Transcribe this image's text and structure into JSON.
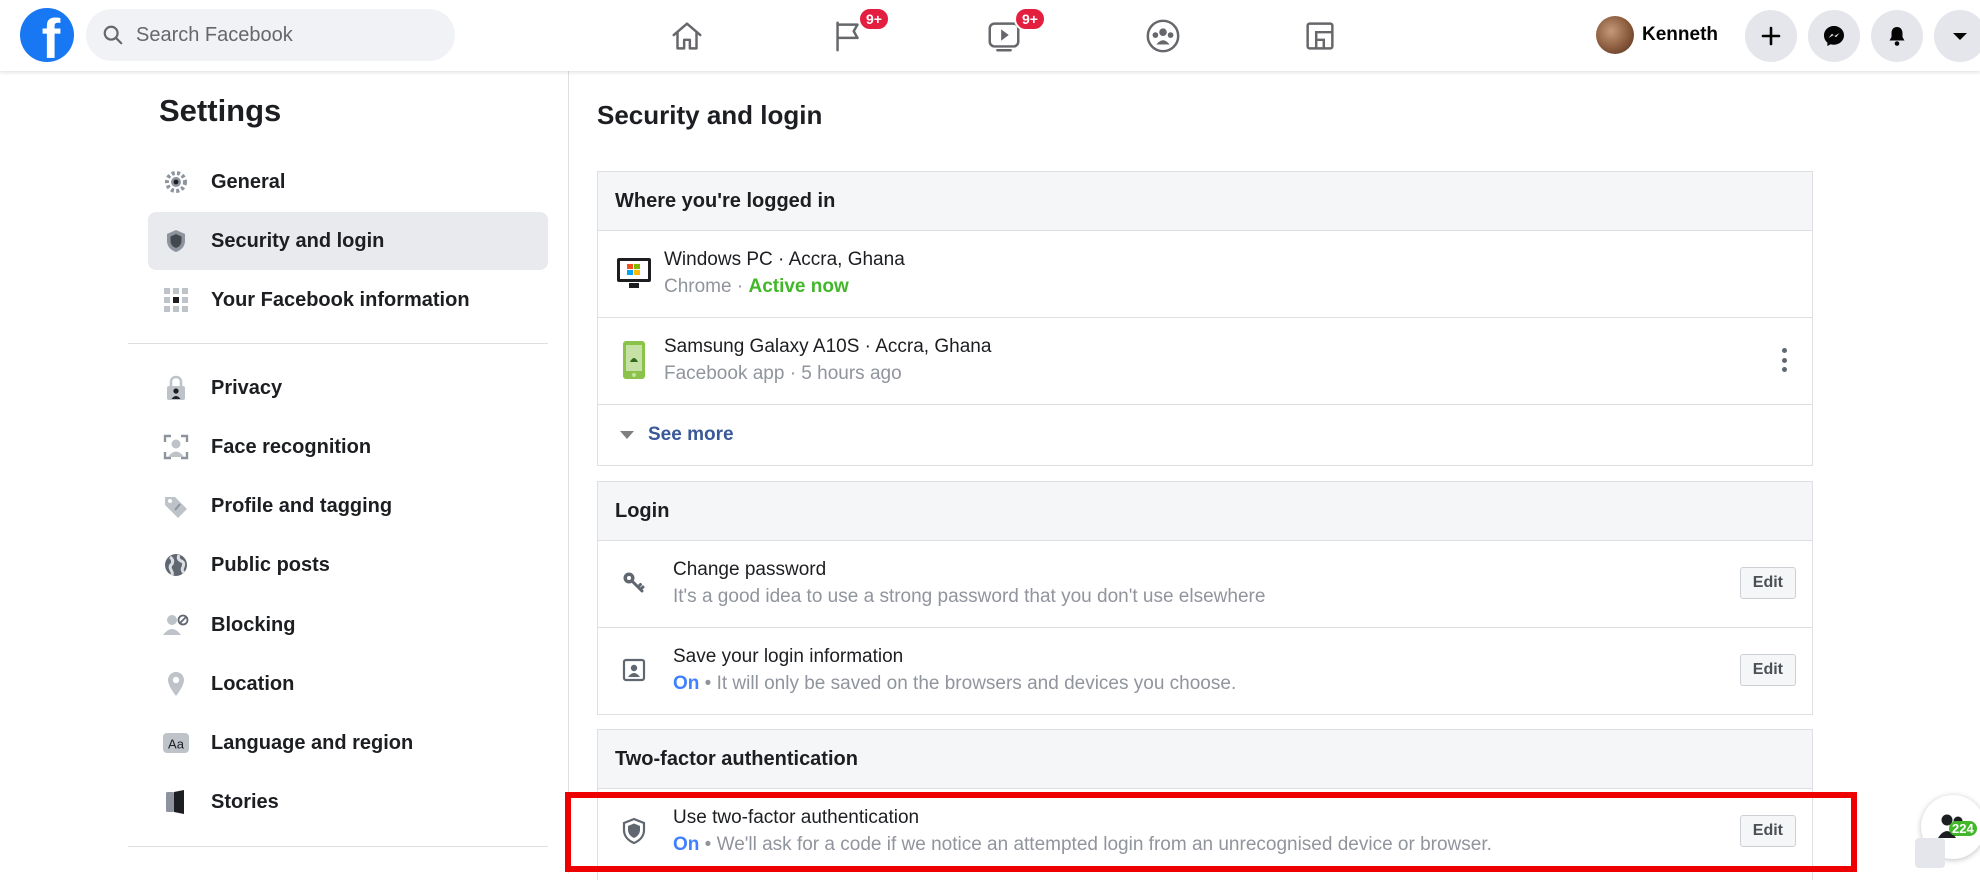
{
  "topbar": {
    "search_placeholder": "Search Facebook",
    "nav": [
      {
        "icon": "home-icon"
      },
      {
        "icon": "pages-flag-icon",
        "badge": "9+"
      },
      {
        "icon": "watch-video-icon",
        "badge": "9+"
      },
      {
        "icon": "groups-icon"
      },
      {
        "icon": "gaming-icon"
      }
    ],
    "profile_name": "Kenneth",
    "buttons": [
      "create-plus-icon",
      "messenger-icon",
      "notifications-bell-icon",
      "account-caret-icon"
    ]
  },
  "sidebar": {
    "title": "Settings",
    "items": [
      {
        "label": "General",
        "icon": "gear-icon"
      },
      {
        "label": "Security and login",
        "icon": "shield-icon",
        "active": true
      },
      {
        "label": "Your Facebook information",
        "icon": "grid-info-icon"
      },
      {
        "label": "Privacy",
        "icon": "lock-person-icon"
      },
      {
        "label": "Face recognition",
        "icon": "face-scan-icon"
      },
      {
        "label": "Profile and tagging",
        "icon": "tag-icon"
      },
      {
        "label": "Public posts",
        "icon": "globe-icon"
      },
      {
        "label": "Blocking",
        "icon": "block-user-icon"
      },
      {
        "label": "Location",
        "icon": "location-pin-icon"
      },
      {
        "label": "Language and region",
        "icon": "language-aa-icon"
      },
      {
        "label": "Stories",
        "icon": "book-icon"
      }
    ]
  },
  "main": {
    "title": "Security and login",
    "logged_in": {
      "header": "Where you're logged in",
      "sessions": [
        {
          "device": "Windows PC · Accra, Ghana",
          "app": "Chrome · ",
          "status": "Active now",
          "icon": "desktop-windows-icon"
        },
        {
          "device": "Samsung Galaxy A10S · Accra, Ghana",
          "app": "Facebook app · 5 hours ago",
          "icon": "android-phone-icon"
        }
      ],
      "see_more": "See more"
    },
    "login": {
      "header": "Login",
      "rows": [
        {
          "title": "Change password",
          "sub": "It's a good idea to use a strong password that you don't use elsewhere",
          "button": "Edit",
          "icon": "key-icon"
        },
        {
          "title": "Save your login information",
          "status": "On",
          "sub": " • It will only be saved on the browsers and devices you choose.",
          "button": "Edit",
          "icon": "id-card-icon"
        }
      ]
    },
    "two_factor": {
      "header": "Two-factor authentication",
      "rows": [
        {
          "title": "Use two-factor authentication",
          "status": "On",
          "sub": " • We'll ask for a code if we notice an attempted login from an unrecognised device or browser.",
          "button": "Edit",
          "icon": "shield-icon"
        }
      ]
    }
  },
  "floating": {
    "count": "224",
    "icon": "contacts-people-icon"
  },
  "colors": {
    "brand": "#1877f2",
    "badge": "#e41e3f",
    "active_now": "#42b72a",
    "on": "#4080ff",
    "highlight": "#ee0000",
    "link": "#385898"
  }
}
